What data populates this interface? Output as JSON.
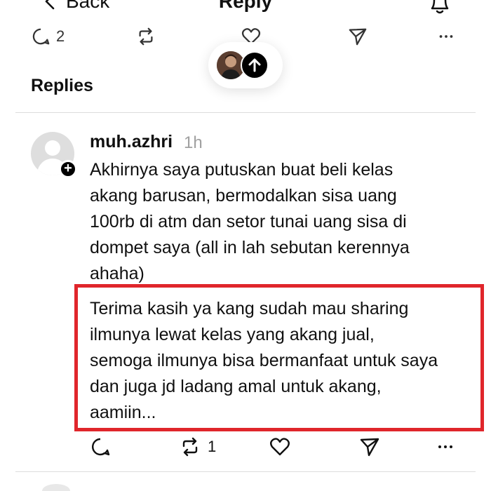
{
  "nav": {
    "back_label": "Back",
    "title": "Reply"
  },
  "top_actions": {
    "reply_count": "2"
  },
  "section": {
    "title": "Replies"
  },
  "reply": {
    "username": "muh.azhri",
    "time": "1h",
    "lines": [
      "Akhirnya saya putuskan buat beli kelas",
      "akang barusan, bermodalkan sisa uang",
      "100rb di atm dan setor tunai uang sisa di",
      "dompet saya (all in lah sebutan kerennya",
      "ahaha)"
    ],
    "highlight_lines": [
      "Terima kasih ya kang sudah mau sharing",
      "ilmunya lewat kelas yang akang jual,",
      "semoga ilmunya bisa bermanfaat untuk saya",
      "dan juga jd ladang amal untuk akang,",
      "aamiin..."
    ],
    "repost_count": "1"
  },
  "colors": {
    "highlight_border": "#e0262b",
    "divider": "#dcdcdc",
    "time": "#a0a0a0"
  },
  "icons": [
    "chevron-left-icon",
    "bell-icon",
    "comment-icon",
    "repost-icon",
    "heart-icon",
    "share-icon",
    "more-icon",
    "arrow-up-icon",
    "plus-icon"
  ]
}
